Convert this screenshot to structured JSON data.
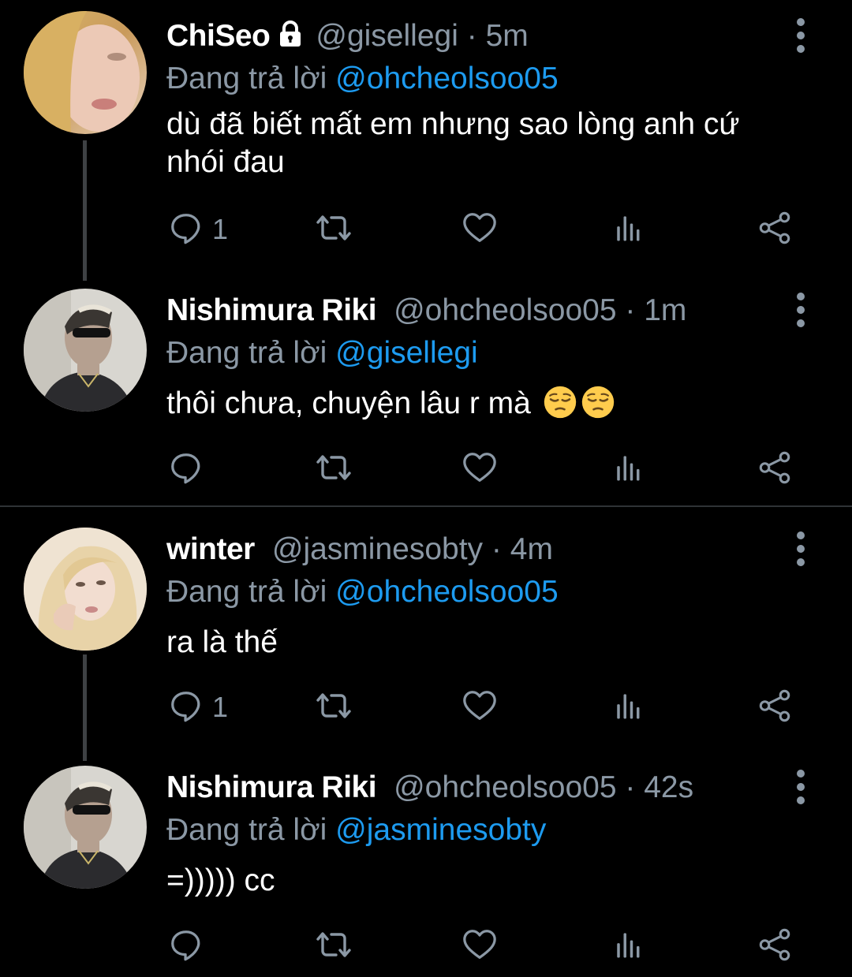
{
  "colors": {
    "background": "#000000",
    "name": "#ffffff",
    "secondary": "#8b98a5",
    "mention": "#1d9bf0",
    "thread_line": "#3e4144"
  },
  "tweets": [
    {
      "name": "ChiSeo",
      "protected": true,
      "handle": "@gisellegi",
      "separator": "·",
      "time": "5m",
      "reply_prefix": "Đang trả lời",
      "reply_to": "@ohcheolsoo05",
      "text": "dù đã biết mất em nhưng sao lòng anh cứ nhói đau",
      "reply_count": "1"
    },
    {
      "name": "Nishimura Riki",
      "handle": "@ohcheolsoo05",
      "separator": "·",
      "time": "1m",
      "reply_prefix": "Đang trả lời",
      "reply_to": "@gisellegi",
      "text": "thôi chưa, chuyện lâu r mà",
      "emojis": [
        "pensive-face",
        "pensive-face"
      ],
      "reply_count": ""
    },
    {
      "name": "winter",
      "handle": "@jasminesobty",
      "separator": "·",
      "time": "4m",
      "reply_prefix": "Đang trả lời",
      "reply_to": "@ohcheolsoo05",
      "text": "ra là thế",
      "reply_count": "1"
    },
    {
      "name": "Nishimura Riki",
      "handle": "@ohcheolsoo05",
      "separator": "·",
      "time": "42s",
      "reply_prefix": "Đang trả lời",
      "reply_to": "@jasminesobty",
      "text": "=))))) cc",
      "reply_count": ""
    }
  ],
  "icons": [
    "reply-icon",
    "retweet-icon",
    "like-icon",
    "views-icon",
    "share-icon",
    "more-icon",
    "lock-icon"
  ]
}
